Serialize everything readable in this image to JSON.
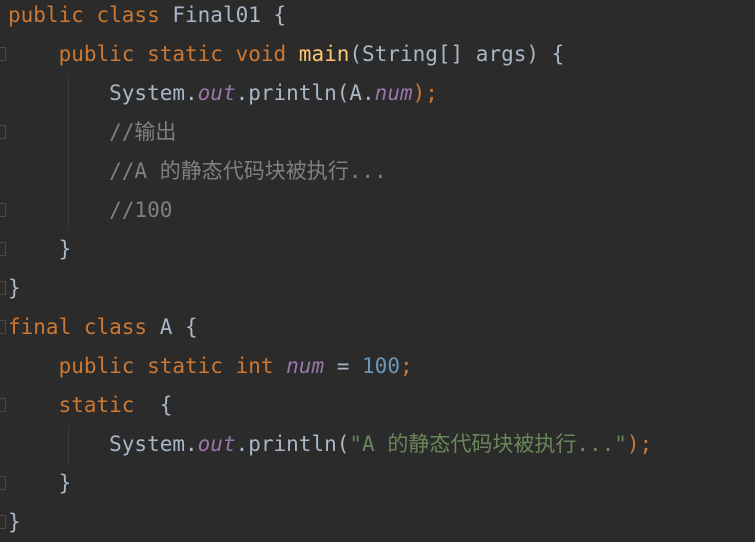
{
  "code": {
    "lines": [
      [
        {
          "t": "public class ",
          "c": "kw"
        },
        {
          "t": "Final01 {",
          "c": "pl"
        }
      ],
      [
        {
          "t": "    public static void ",
          "c": "kw"
        },
        {
          "t": "main",
          "c": "fn"
        },
        {
          "t": "(String[] args) {",
          "c": "pl"
        }
      ],
      [
        {
          "t": "        System.",
          "c": "pl"
        },
        {
          "t": "out",
          "c": "st"
        },
        {
          "t": ".println(A.",
          "c": "pl"
        },
        {
          "t": "num",
          "c": "st"
        },
        {
          "t": ");",
          "c": "kw"
        }
      ],
      [
        {
          "t": "        //输出",
          "c": "cm"
        }
      ],
      [
        {
          "t": "        //A 的静态代码块被执行...",
          "c": "cm"
        }
      ],
      [
        {
          "t": "        //100",
          "c": "cm"
        }
      ],
      [
        {
          "t": "    }",
          "c": "pl"
        }
      ],
      [
        {
          "t": "}",
          "c": "pl"
        }
      ],
      [
        {
          "t": "final class ",
          "c": "kw"
        },
        {
          "t": "A {",
          "c": "pl"
        }
      ],
      [
        {
          "t": "    public static int ",
          "c": "kw"
        },
        {
          "t": "num",
          "c": "st"
        },
        {
          "t": " = ",
          "c": "pl"
        },
        {
          "t": "100",
          "c": "nm"
        },
        {
          "t": ";",
          "c": "kw"
        }
      ],
      [
        {
          "t": "    static  ",
          "c": "kw"
        },
        {
          "t": "{",
          "c": "pl"
        }
      ],
      [
        {
          "t": "        System.",
          "c": "pl"
        },
        {
          "t": "out",
          "c": "st"
        },
        {
          "t": ".println(",
          "c": "pl"
        },
        {
          "t": "\"A 的静态代码块被执行...\"",
          "c": "str"
        },
        {
          "t": ");",
          "c": "kw"
        }
      ],
      [
        {
          "t": "    }",
          "c": "pl"
        }
      ],
      [
        {
          "t": "}",
          "c": "pl"
        }
      ]
    ]
  }
}
